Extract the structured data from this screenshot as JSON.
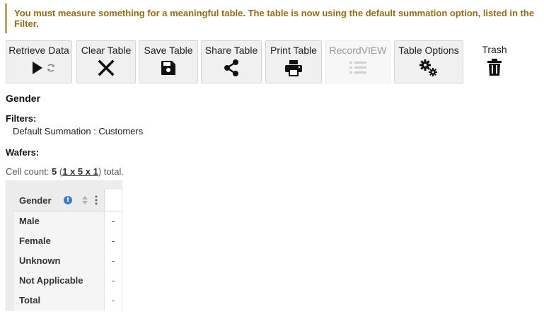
{
  "warning": {
    "text": "You must measure something for a meaningful table. The table is now using the default summation option, listed in the Filter."
  },
  "toolbar": {
    "buttons": [
      {
        "label": "Retrieve Data",
        "icon": "play-icon"
      },
      {
        "label": "Clear Table",
        "icon": "close-icon"
      },
      {
        "label": "Save Table",
        "icon": "save-icon"
      },
      {
        "label": "Share Table",
        "icon": "share-icon"
      },
      {
        "label": "Print Table",
        "icon": "print-icon"
      },
      {
        "label": "RecordVIEW",
        "icon": "list-icon",
        "disabled": true
      },
      {
        "label": "Table Options",
        "icon": "gears-icon"
      },
      {
        "label": "Trash",
        "icon": "trash-icon"
      }
    ]
  },
  "table_title": "Gender",
  "filters": {
    "heading": "Filters:",
    "items": [
      "Default Summation : Customers"
    ]
  },
  "wafers": {
    "heading": "Wafers:"
  },
  "cell_count": {
    "prefix": "Cell count: ",
    "count": "5",
    "open": " (",
    "dims": "1 x 5 x 1",
    "close": ") total."
  },
  "grid": {
    "column_header": "Gender",
    "rows": [
      {
        "label": "Male",
        "value": "-"
      },
      {
        "label": "Female",
        "value": "-"
      },
      {
        "label": "Unknown",
        "value": "-"
      },
      {
        "label": "Not Applicable",
        "value": "-"
      },
      {
        "label": "Total",
        "value": "-"
      }
    ]
  },
  "colors": {
    "warning_text": "#9c6a12",
    "warning_border": "#c8a24a",
    "info_blue": "#3d7ac9"
  }
}
